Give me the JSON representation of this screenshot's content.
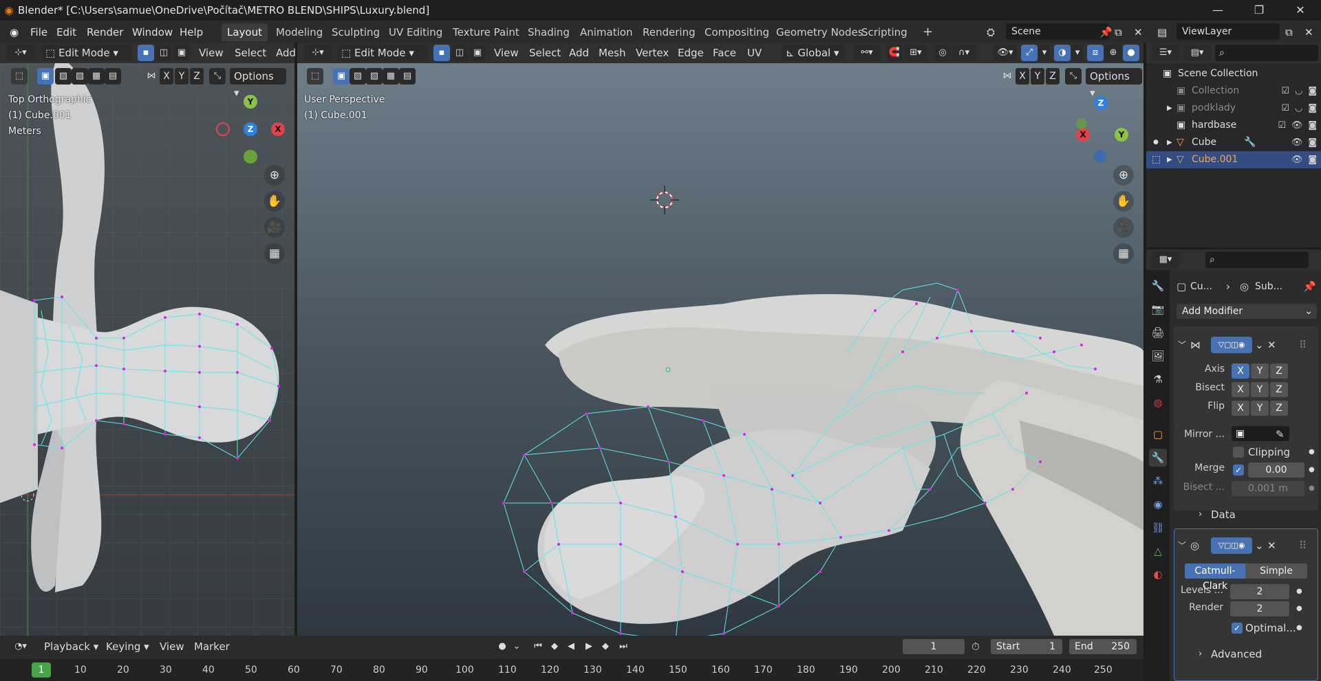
{
  "window": {
    "title": "Blender* [C:\\Users\\samue\\OneDrive\\Počítač\\METRO BLEND\\SHIPS\\Luxury.blend]",
    "minimize_glyph": "—",
    "maximize_glyph": "❐",
    "close_glyph": "✕"
  },
  "menu": [
    "File",
    "Edit",
    "Render",
    "Window",
    "Help"
  ],
  "workspaces": [
    "Layout",
    "Modeling",
    "Sculpting",
    "UV Editing",
    "Texture Paint",
    "Shading",
    "Animation",
    "Rendering",
    "Compositing",
    "Geometry Nodes",
    "Scripting"
  ],
  "workspace_add": "+",
  "scene_name": "Scene",
  "view_layer": "ViewLayer",
  "left_viewport": {
    "mode": "Edit Mode",
    "menus": [
      "View",
      "Select",
      "Add"
    ],
    "options": "Options",
    "view_name": "Top Orthographic",
    "object_name": "(1) Cube.001",
    "units": "Meters",
    "axes": {
      "y": "Y",
      "z": "Z",
      "x": "X"
    },
    "xyz": [
      "X",
      "Y",
      "Z"
    ]
  },
  "main_viewport": {
    "mode": "Edit Mode",
    "menus": [
      "View",
      "Select",
      "Add",
      "Mesh",
      "Vertex",
      "Edge",
      "Face",
      "UV"
    ],
    "transform_orientation": "Global",
    "options": "Options",
    "view_name": "User Perspective",
    "object_name": "(1) Cube.001",
    "axes": {
      "z": "Z",
      "x": "X",
      "y": "Y"
    },
    "xyz": [
      "X",
      "Y",
      "Z"
    ]
  },
  "outliner": {
    "root": "Scene Collection",
    "items": [
      {
        "name": "Collection",
        "dim": true
      },
      {
        "name": "podklady",
        "dim": true
      },
      {
        "name": "hardbase",
        "dim": false
      },
      {
        "name": "Cube",
        "dim": false
      },
      {
        "name": "Cube.001",
        "dim": false,
        "selected": true
      }
    ]
  },
  "properties": {
    "breadcrumb_object": "Cu...",
    "breadcrumb_modifier": "Sub...",
    "add_modifier": "Add Modifier",
    "mirror": {
      "axis_label": "Axis",
      "bisect_label": "Bisect",
      "flip_label": "Flip",
      "axes": [
        "X",
        "Y",
        "Z"
      ],
      "mirror_object_label": "Mirror ...",
      "clipping_label": "Clipping",
      "merge_label": "Merge",
      "merge_value": "0.00",
      "bisect_distance_label": "Bisect ...",
      "bisect_distance_value": "0.001 m",
      "data_label": "Data"
    },
    "subsurf": {
      "catmull": "Catmull-Clark",
      "simple": "Simple",
      "levels_label": "Levels ...",
      "levels_value": "2",
      "render_label": "Render",
      "render_value": "2",
      "optimal_label": "Optimal...",
      "advanced_label": "Advanced"
    }
  },
  "timeline": {
    "menus": [
      "Playback",
      "Keying",
      "View",
      "Marker"
    ],
    "current_frame": "1",
    "start_label": "Start",
    "start_value": "1",
    "end_label": "End",
    "end_value": "250",
    "frame_marks": [
      "10",
      "20",
      "30",
      "40",
      "50",
      "60",
      "70",
      "80",
      "90",
      "100",
      "110",
      "120",
      "130",
      "140",
      "150",
      "160",
      "170",
      "180",
      "190",
      "200",
      "210",
      "220",
      "230",
      "240",
      "250"
    ]
  },
  "colors": {
    "selection_blue": "#4772b3",
    "wire_cyan": "#5fe7e7",
    "vertex_magenta": "#e61ee6",
    "active_object_orange": "#f0a55a"
  }
}
